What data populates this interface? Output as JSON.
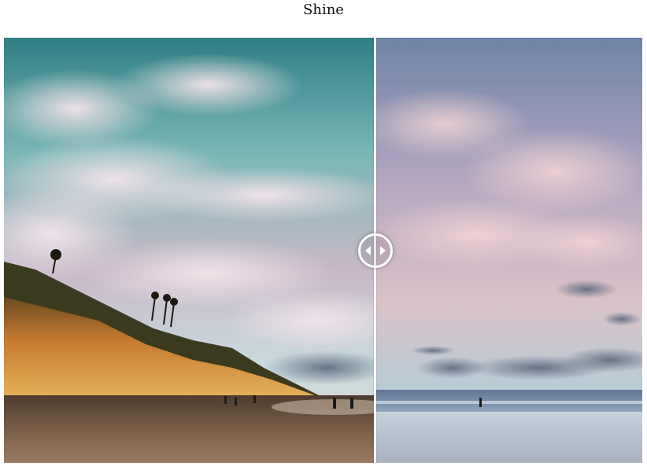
{
  "page": {
    "title": "Shine"
  },
  "comparison": {
    "before_image": "enhanced-beach-sunset-photo",
    "after_image": "original-beach-sunset-photo",
    "split_position": 0.58,
    "handle_icon": "left-right-arrows-icon"
  },
  "colors": {
    "handle": "#ffffff",
    "divider": "#ffffff",
    "sky_left": "#3f8f92",
    "sky_right": "#7e96b6",
    "cliff": "#c9782f",
    "sand": "#7a6048"
  }
}
